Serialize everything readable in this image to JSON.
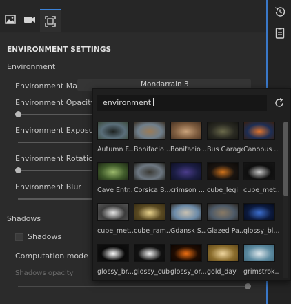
{
  "toolbar": {
    "tabs": [
      {
        "icon": "image-icon"
      },
      {
        "icon": "camera-icon"
      },
      {
        "icon": "frame-icon",
        "active": true
      }
    ],
    "accent_color": "#3b82d8"
  },
  "right_toolbar": {
    "icons": [
      "history-icon",
      "notes-icon"
    ]
  },
  "panel": {
    "section_title": "ENVIRONMENT SETTINGS",
    "environment_group": "Environment",
    "environment_map_label": "Environment Map",
    "environment_map_value": "Mondarrain 3",
    "opacity_label": "Environment Opacity",
    "opacity_level": 0.0,
    "exposure_label": "Environment Exposure",
    "rotation_label": "Environment Rotation",
    "rotation_level": 0.0,
    "blur_label": "Environment Blur",
    "shadows_group": "Shadows",
    "shadows_checkbox_label": "Shadows",
    "computation_mode_label": "Computation mode",
    "shadows_opacity_label": "Shadows opacity",
    "shadows_opacity_level": 1.0
  },
  "picker": {
    "search_value": "environment",
    "refresh_icon": "refresh-icon",
    "items": [
      {
        "name": "Autumn F...",
        "c1": "#5a6e7a",
        "c2": "#1d2220",
        "c3": "#3b4a3b"
      },
      {
        "name": "Bonifacio ...",
        "c1": "#6f7f8c",
        "c2": "#9a7b57",
        "c3": "#3c3328"
      },
      {
        "name": "Bonifacio ...",
        "c1": "#7c5b3e",
        "c2": "#c9a27a",
        "c3": "#4a3424"
      },
      {
        "name": "Bus Garage",
        "c1": "#2a2a22",
        "c2": "#6b6a4b",
        "c3": "#161612"
      },
      {
        "name": "Canopus ...",
        "c1": "#1d2e55",
        "c2": "#e0742c",
        "c3": "#3a2010"
      },
      {
        "name": "Cave Entr...",
        "c1": "#3f5a2a",
        "c2": "#9ab86b",
        "c3": "#1c2614"
      },
      {
        "name": "Corsica B...",
        "c1": "#6d7781",
        "c2": "#3b3a35",
        "c3": "#20201c"
      },
      {
        "name": "crimson ...",
        "c1": "#1b1d43",
        "c2": "#4a3c8a",
        "c3": "#0e0f22"
      },
      {
        "name": "cube_legi...",
        "c1": "#1a1410",
        "c2": "#d0731c",
        "c3": "#0c0a08"
      },
      {
        "name": "cube_met...",
        "c1": "#0f0f0f",
        "c2": "#c8c8c8",
        "c3": "#151515"
      },
      {
        "name": "cube_met...",
        "c1": "#3c3c3c",
        "c2": "#e8e8e8",
        "c3": "#555555"
      },
      {
        "name": "cube_ram...",
        "c1": "#5a4a22",
        "c2": "#e9d38d",
        "c3": "#3a2f14"
      },
      {
        "name": "Gdansk S...",
        "c1": "#6b8aa8",
        "c2": "#c9c1b1",
        "c3": "#2f2a25"
      },
      {
        "name": "Glazed Pa...",
        "c1": "#4d5a68",
        "c2": "#8a7a64",
        "c3": "#2a2520"
      },
      {
        "name": "glossy_bl...",
        "c1": "#0c1a3e",
        "c2": "#3c6fd0",
        "c3": "#050a18"
      },
      {
        "name": "glossy_br...",
        "c1": "#0a0a0a",
        "c2": "#ffffff",
        "c3": "#101010"
      },
      {
        "name": "glossy_cube",
        "c1": "#111111",
        "c2": "#f3f3f3",
        "c3": "#0c0c0c"
      },
      {
        "name": "glossy_or...",
        "c1": "#1e0c02",
        "c2": "#f07012",
        "c3": "#0b0401"
      },
      {
        "name": "gold_day",
        "c1": "#8b6d2d",
        "c2": "#f0d7a0",
        "c3": "#5e4618"
      },
      {
        "name": "grimstrok...",
        "c1": "#5c8aa0",
        "c2": "#dfe8ec",
        "c3": "#3b6376"
      }
    ]
  }
}
